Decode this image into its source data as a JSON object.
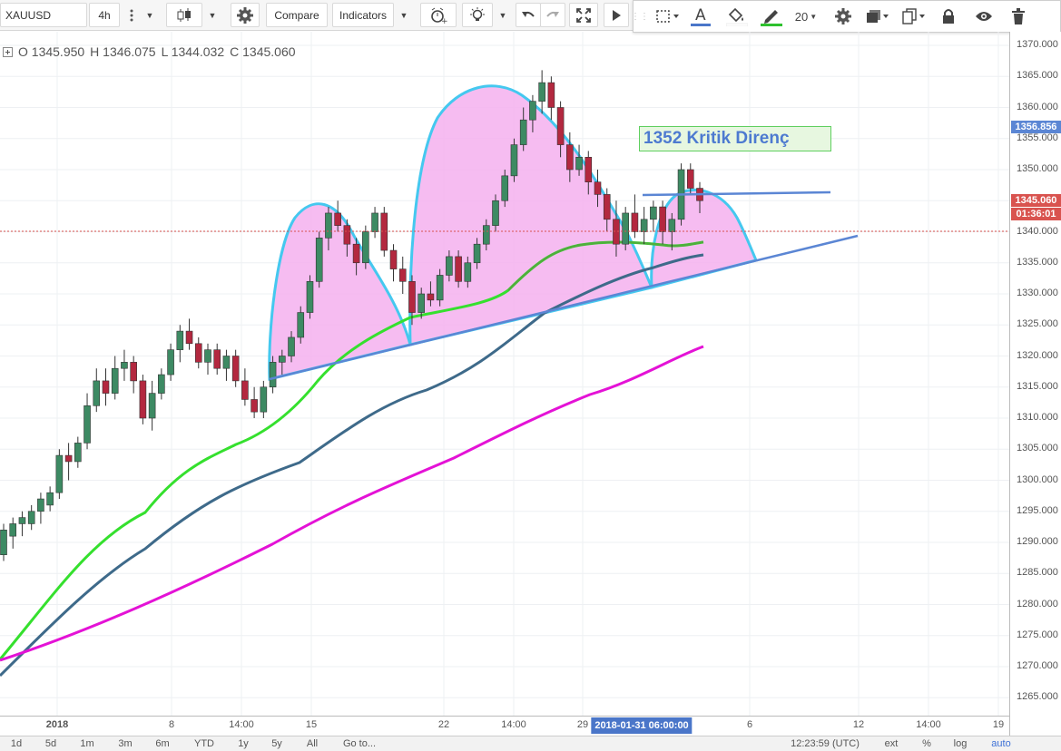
{
  "toolbar": {
    "symbol": "XAUUSD",
    "interval": "4h",
    "compare_label": "Compare",
    "indicators_label": "Indicators",
    "line_width": "20"
  },
  "ohlc": {
    "open": "O 1345.950",
    "high": "H 1346.075",
    "low": "L 1344.032",
    "close": "C 1345.060"
  },
  "annotation": {
    "text": "1352 Kritik Direnç"
  },
  "price_axis": {
    "ticks": [
      "1370.000",
      "1365.000",
      "1360.000",
      "1355.000",
      "1350.000",
      "1345.000",
      "1340.000",
      "1335.000",
      "1330.000",
      "1325.000",
      "1320.000",
      "1315.000",
      "1310.000",
      "1305.000",
      "1300.000",
      "1295.000",
      "1290.000",
      "1285.000",
      "1280.000",
      "1275.000",
      "1270.000",
      "1265.000"
    ],
    "resistance_label": "1356.856",
    "last_price_label": "1345.060",
    "countdown_label": "01:36:01"
  },
  "time_axis": {
    "ticks": [
      "2018",
      "8",
      "14:00",
      "15",
      "22",
      "14:00",
      "29",
      "6",
      "12",
      "14:00",
      "19"
    ],
    "highlight": "2018-01-31 06:00:00"
  },
  "bottombar": {
    "ranges": [
      "1d",
      "5d",
      "1m",
      "3m",
      "6m",
      "YTD",
      "1y",
      "5y",
      "All"
    ],
    "goto_label": "Go to...",
    "clock": "12:23:59 (UTC)",
    "ext_label": "ext",
    "percent_label": "%",
    "log_label": "log",
    "auto_label": "auto"
  },
  "colors": {
    "bull": "#3d8a63",
    "bear": "#b3283f",
    "pattern_fill": "#f5b0ef",
    "pattern_stroke": "#45c8ef",
    "trendline": "#5b86d4",
    "ma_short": "#35e02e",
    "ma_short_inner": "#4fae3c",
    "ma_mid": "#3e6a8a",
    "ma_long": "#e412d6",
    "last_price": "#d9534f",
    "resistance_label_bg": "#5b86d4"
  },
  "chart_data": {
    "type": "candlestick",
    "symbol": "XAUUSD",
    "interval": "4h",
    "ylim": [
      1262,
      1372
    ],
    "candles_ohlc": [
      [
        1288,
        1293,
        1287,
        1292
      ],
      [
        1291,
        1294,
        1289,
        1293
      ],
      [
        1293,
        1295,
        1291,
        1294
      ],
      [
        1293,
        1296,
        1292,
        1295
      ],
      [
        1295,
        1298,
        1293,
        1297
      ],
      [
        1296,
        1299,
        1295,
        1298
      ],
      [
        1298,
        1305,
        1297,
        1304
      ],
      [
        1304,
        1306,
        1300,
        1303
      ],
      [
        1303,
        1307,
        1302,
        1306
      ],
      [
        1306,
        1314,
        1305,
        1312
      ],
      [
        1312,
        1318,
        1311,
        1316
      ],
      [
        1316,
        1318,
        1312,
        1314
      ],
      [
        1314,
        1320,
        1313,
        1318
      ],
      [
        1318,
        1321,
        1316,
        1319
      ],
      [
        1319,
        1320,
        1314,
        1316
      ],
      [
        1316,
        1317,
        1309,
        1310
      ],
      [
        1310,
        1316,
        1308,
        1314
      ],
      [
        1314,
        1318,
        1313,
        1317
      ],
      [
        1317,
        1322,
        1316,
        1321
      ],
      [
        1321,
        1325,
        1319,
        1324
      ],
      [
        1324,
        1326,
        1321,
        1322
      ],
      [
        1322,
        1323,
        1318,
        1319
      ],
      [
        1319,
        1322,
        1317,
        1321
      ],
      [
        1321,
        1322,
        1317,
        1318
      ],
      [
        1318,
        1321,
        1316,
        1320
      ],
      [
        1320,
        1321,
        1315,
        1316
      ],
      [
        1316,
        1318,
        1312,
        1313
      ],
      [
        1313,
        1315,
        1310,
        1311
      ],
      [
        1311,
        1316,
        1310,
        1315
      ],
      [
        1315,
        1320,
        1314,
        1319
      ],
      [
        1319,
        1321,
        1317,
        1320
      ],
      [
        1320,
        1324,
        1319,
        1323
      ],
      [
        1323,
        1328,
        1322,
        1327
      ],
      [
        1327,
        1333,
        1326,
        1332
      ],
      [
        1332,
        1340,
        1331,
        1339
      ],
      [
        1339,
        1344,
        1337,
        1343
      ],
      [
        1343,
        1345,
        1340,
        1341
      ],
      [
        1341,
        1342,
        1336,
        1338
      ],
      [
        1338,
        1339,
        1333,
        1335
      ],
      [
        1335,
        1341,
        1334,
        1340
      ],
      [
        1340,
        1344,
        1339,
        1343
      ],
      [
        1343,
        1344,
        1336,
        1337
      ],
      [
        1337,
        1338,
        1332,
        1334
      ],
      [
        1334,
        1336,
        1330,
        1332
      ],
      [
        1332,
        1333,
        1325,
        1327
      ],
      [
        1327,
        1331,
        1326,
        1330
      ],
      [
        1330,
        1332,
        1328,
        1329
      ],
      [
        1329,
        1334,
        1328,
        1333
      ],
      [
        1333,
        1337,
        1332,
        1336
      ],
      [
        1336,
        1337,
        1331,
        1332
      ],
      [
        1332,
        1336,
        1331,
        1335
      ],
      [
        1335,
        1339,
        1334,
        1338
      ],
      [
        1338,
        1342,
        1337,
        1341
      ],
      [
        1341,
        1346,
        1340,
        1345
      ],
      [
        1345,
        1350,
        1344,
        1349
      ],
      [
        1349,
        1355,
        1348,
        1354
      ],
      [
        1354,
        1360,
        1353,
        1358
      ],
      [
        1358,
        1362,
        1356,
        1361
      ],
      [
        1361,
        1366,
        1359,
        1364
      ],
      [
        1364,
        1365,
        1358,
        1360
      ],
      [
        1360,
        1361,
        1352,
        1354
      ],
      [
        1354,
        1356,
        1348,
        1350
      ],
      [
        1350,
        1354,
        1349,
        1352
      ],
      [
        1352,
        1353,
        1346,
        1348
      ],
      [
        1348,
        1350,
        1344,
        1346
      ],
      [
        1346,
        1347,
        1340,
        1342
      ],
      [
        1342,
        1345,
        1336,
        1338
      ],
      [
        1338,
        1344,
        1337,
        1343
      ],
      [
        1343,
        1346,
        1339,
        1340
      ],
      [
        1340,
        1344,
        1338,
        1342
      ],
      [
        1342,
        1345,
        1340,
        1344
      ],
      [
        1344,
        1345,
        1338,
        1340
      ],
      [
        1340,
        1343,
        1337,
        1342
      ],
      [
        1342,
        1351,
        1341,
        1350
      ],
      [
        1350,
        1351,
        1346,
        1347
      ],
      [
        1347,
        1348,
        1343,
        1345
      ]
    ],
    "moving_averages": [
      {
        "color": "#35e02e",
        "start": 1271,
        "end": 1343
      },
      {
        "color": "#3e6a8a",
        "start": 1268,
        "end": 1336.5
      },
      {
        "color": "#e412d6",
        "start": 1271,
        "end": 1321.5
      }
    ],
    "annotations": [
      "1352 Kritik Direnç"
    ]
  }
}
